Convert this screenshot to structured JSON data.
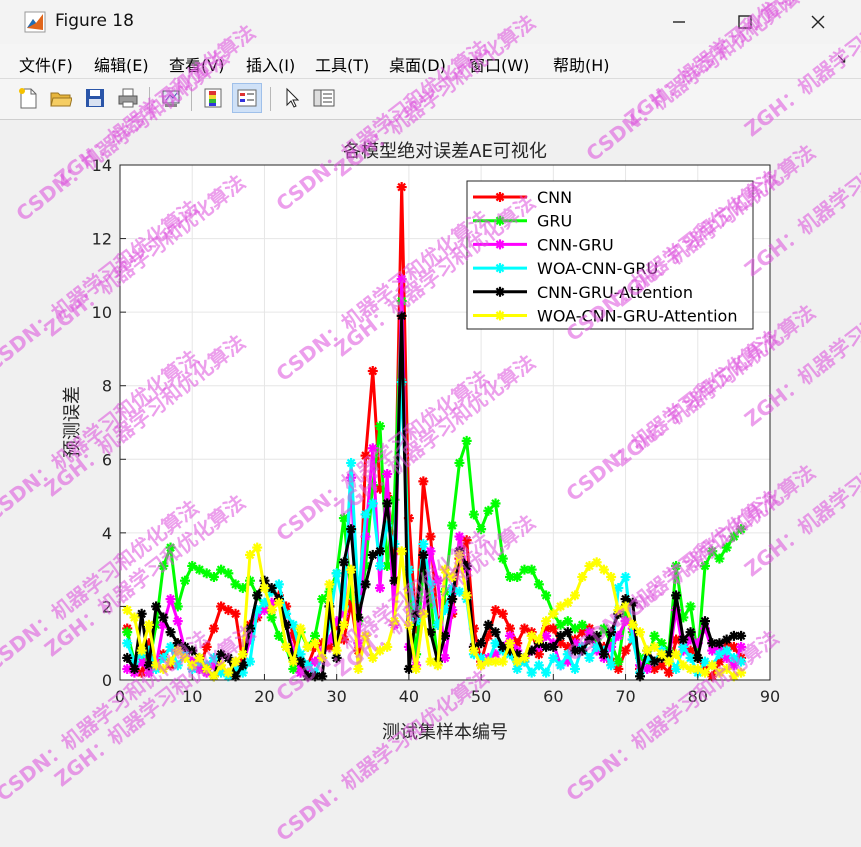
{
  "window": {
    "title": "Figure 18"
  },
  "menu": [
    "文件(F)",
    "编辑(E)",
    "查看(V)",
    "插入(I)",
    "工具(T)",
    "桌面(D)",
    "窗口(W)",
    "帮助(H)"
  ],
  "toolbar": [
    {
      "icon": "new-file-icon"
    },
    {
      "icon": "open-folder-icon"
    },
    {
      "icon": "save-icon"
    },
    {
      "icon": "print-icon"
    },
    {
      "icon": "link-plot-icon"
    },
    {
      "icon": "insert-colorbar-icon"
    },
    {
      "icon": "insert-legend-icon",
      "active": true
    },
    {
      "icon": "edit-plot-pointer-icon"
    },
    {
      "icon": "property-inspector-icon"
    }
  ],
  "watermark": "ZGH：机器学习和优化算法",
  "watermark2": "CSDN：机器学习和优化算法",
  "chart_data": {
    "type": "line",
    "title": "各模型绝对误差AE可视化",
    "xlabel": "测试集样本编号",
    "ylabel": "预测误差",
    "xlim": [
      0,
      90
    ],
    "ylim": [
      0,
      14
    ],
    "xticks": [
      0,
      10,
      20,
      30,
      40,
      50,
      60,
      70,
      80,
      90
    ],
    "yticks": [
      0,
      2,
      4,
      6,
      8,
      10,
      12,
      14
    ],
    "grid": true,
    "legend_position": "top-right",
    "series": [
      {
        "name": "CNN",
        "color": "#ff0000",
        "values": [
          1.4,
          0.3,
          0.2,
          1.0,
          0.5,
          0.7,
          0.4,
          1.0,
          0.8,
          0.5,
          0.3,
          0.9,
          1.4,
          2.0,
          1.9,
          1.8,
          0.5,
          1.5,
          1.7,
          2.0,
          1.9,
          2.3,
          2.0,
          1.2,
          0.3,
          0.4,
          0.9,
          1.0,
          0.9,
          1.5,
          1.1,
          2.1,
          0.8,
          6.1,
          8.4,
          5.2,
          5.0,
          3.5,
          13.4,
          4.4,
          1.4,
          5.4,
          3.9,
          1.5,
          2.1,
          1.8,
          3.3,
          3.8,
          1.4,
          0.5,
          1.2,
          1.9,
          1.8,
          1.4,
          1.0,
          1.4,
          1.3,
          0.7,
          1.4,
          1.4,
          1.0,
          0.9,
          1.1,
          1.3,
          1.4,
          0.9,
          0.9,
          0.5,
          0.3,
          0.8,
          1.1,
          0.3,
          0.5,
          0.3,
          0.4,
          0.2,
          1.1,
          0.9,
          0.8,
          0.6,
          0.3,
          0.1,
          0.5,
          1.0,
          0.9,
          0.6
        ]
      },
      {
        "name": "GRU",
        "color": "#00ff00",
        "values": [
          1.3,
          0.5,
          0.7,
          0.4,
          1.5,
          3.1,
          3.6,
          2.0,
          2.7,
          3.1,
          3.0,
          2.9,
          2.8,
          3.0,
          2.9,
          2.6,
          2.5,
          2.7,
          2.3,
          2.0,
          1.7,
          1.2,
          0.9,
          0.3,
          1.3,
          0.9,
          1.2,
          2.2,
          2.4,
          2.9,
          4.4,
          2.3,
          1.6,
          3.1,
          5.3,
          6.9,
          3.1,
          4.9,
          10.3,
          2.6,
          0.7,
          3.0,
          2.2,
          0.5,
          2.4,
          4.2,
          5.9,
          6.5,
          4.5,
          4.1,
          4.6,
          4.8,
          3.3,
          2.8,
          2.8,
          3.0,
          3.0,
          2.6,
          2.3,
          1.8,
          1.5,
          1.6,
          1.4,
          1.5,
          1.3,
          1.1,
          1.4,
          1.0,
          0.5,
          1.8,
          1.3,
          0.6,
          0.5,
          1.2,
          1.0,
          0.8,
          3.1,
          1.7,
          2.0,
          0.6,
          3.1,
          3.5,
          3.3,
          3.6,
          3.9,
          4.1
        ]
      },
      {
        "name": "CNN-GRU",
        "color": "#ff00ff",
        "values": [
          0.3,
          0.2,
          0.5,
          0.2,
          0.4,
          1.5,
          2.2,
          1.6,
          0.8,
          0.5,
          0.3,
          0.2,
          0.4,
          0.3,
          0.2,
          0.5,
          0.4,
          1.1,
          1.8,
          1.9,
          2.1,
          2.2,
          1.5,
          0.8,
          0.2,
          0.3,
          0.5,
          0.8,
          1.1,
          1.6,
          1.8,
          5.5,
          1.0,
          3.9,
          6.3,
          2.5,
          5.6,
          1.5,
          10.9,
          0.9,
          0.4,
          1.8,
          3.5,
          2.7,
          0.6,
          1.9,
          3.9,
          3.0,
          0.9,
          0.4,
          0.6,
          0.7,
          0.9,
          1.2,
          0.8,
          0.5,
          0.8,
          0.9,
          1.2,
          1.0,
          0.4,
          0.5,
          1.0,
          0.8,
          1.3,
          0.8,
          0.6,
          0.9,
          1.2,
          1.6,
          1.4,
          0.4,
          0.3,
          0.5,
          0.7,
          0.6,
          1.9,
          0.8,
          1.1,
          1.0,
          1.4,
          0.8,
          0.9,
          0.6,
          0.4,
          0.9
        ]
      },
      {
        "name": "WOA-CNN-GRU",
        "color": "#00ffff",
        "values": [
          1.0,
          0.5,
          0.7,
          0.8,
          0.3,
          0.6,
          0.9,
          0.4,
          0.7,
          0.3,
          0.5,
          0.4,
          0.6,
          0.2,
          0.1,
          0.3,
          0.2,
          0.5,
          1.9,
          2.1,
          2.4,
          2.6,
          1.8,
          1.5,
          0.7,
          0.4,
          0.2,
          0.6,
          1.5,
          2.9,
          2.0,
          5.9,
          2.2,
          4.5,
          4.8,
          3.1,
          4.2,
          3.7,
          8.1,
          3.0,
          1.6,
          3.7,
          2.6,
          1.5,
          1.9,
          2.5,
          2.4,
          2.2,
          0.7,
          0.6,
          0.5,
          1.0,
          0.8,
          0.7,
          0.3,
          0.5,
          0.2,
          0.4,
          0.2,
          0.6,
          0.4,
          0.7,
          0.3,
          0.9,
          0.6,
          0.9,
          0.8,
          0.4,
          2.5,
          2.8,
          1.1,
          0.2,
          0.6,
          0.5,
          0.8,
          0.7,
          0.3,
          0.9,
          0.6,
          0.2,
          0.5,
          0.4,
          0.7,
          0.8,
          0.6,
          0.5
        ]
      },
      {
        "name": "CNN-GRU-Attention",
        "color": "#000000",
        "values": [
          0.6,
          0.3,
          1.8,
          0.4,
          2.0,
          1.7,
          1.3,
          1.0,
          0.9,
          0.8,
          0.6,
          0.3,
          0.1,
          0.7,
          0.6,
          0.1,
          0.4,
          1.4,
          2.3,
          2.7,
          2.5,
          2.2,
          1.5,
          0.6,
          0.5,
          0.1,
          0.1,
          0.1,
          2.0,
          0.6,
          3.2,
          4.1,
          1.7,
          2.6,
          3.4,
          3.5,
          4.8,
          2.7,
          9.9,
          0.3,
          1.8,
          3.4,
          1.3,
          0.5,
          1.2,
          2.2,
          3.5,
          3.1,
          0.9,
          1.0,
          1.5,
          1.3,
          0.9,
          0.8,
          0.7,
          0.6,
          0.8,
          1.0,
          0.9,
          0.9,
          1.2,
          1.3,
          0.8,
          0.8,
          1.1,
          1.2,
          0.7,
          1.3,
          1.8,
          2.2,
          2.1,
          0.1,
          0.8,
          0.5,
          0.6,
          0.7,
          2.3,
          1.1,
          1.3,
          0.6,
          1.6,
          1.0,
          1.0,
          1.1,
          1.2,
          1.2
        ]
      },
      {
        "name": "WOA-CNN-GRU-Attention",
        "color": "#ffff00",
        "values": [
          1.9,
          1.7,
          0.8,
          1.5,
          0.4,
          0.3,
          0.5,
          0.8,
          0.6,
          0.4,
          0.6,
          0.3,
          0.1,
          0.4,
          0.2,
          0.5,
          0.7,
          3.4,
          3.6,
          2.5,
          1.9,
          2.1,
          0.9,
          0.5,
          1.4,
          0.9,
          1.0,
          0.6,
          2.6,
          0.8,
          1.5,
          3.0,
          0.3,
          1.2,
          0.6,
          0.8,
          0.9,
          1.6,
          3.5,
          1.5,
          0.3,
          1.8,
          0.5,
          0.4,
          3.0,
          2.8,
          3.4,
          2.3,
          0.8,
          0.4,
          0.5,
          0.5,
          0.5,
          1.0,
          0.5,
          0.6,
          1.2,
          1.1,
          1.6,
          1.8,
          2.0,
          2.1,
          2.3,
          2.8,
          3.1,
          3.2,
          3.0,
          2.8,
          1.9,
          2.0,
          1.5,
          1.3,
          0.8,
          0.9,
          0.7,
          0.5,
          0.7,
          0.4,
          0.3,
          0.3,
          0.2,
          0.4,
          0.2,
          0.3,
          0.1,
          0.2
        ]
      }
    ]
  }
}
